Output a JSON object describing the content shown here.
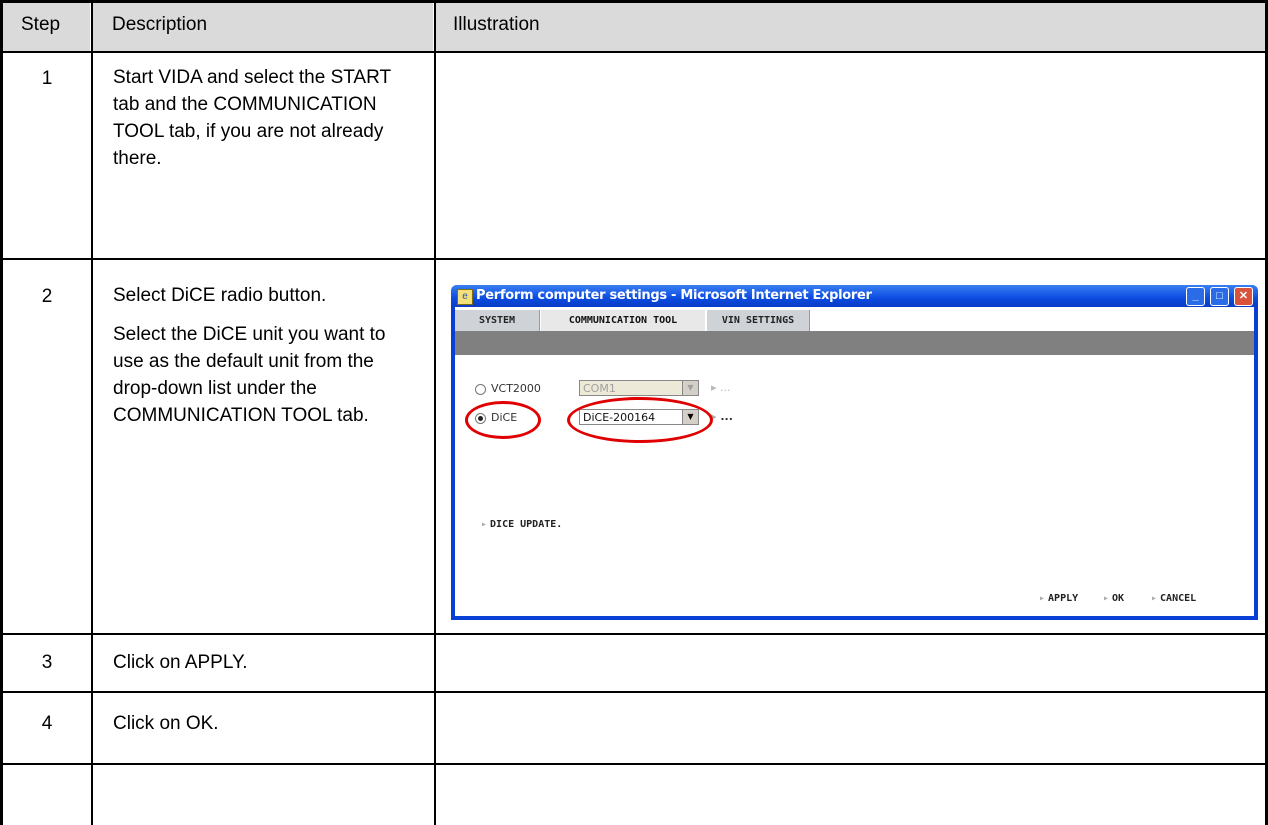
{
  "table": {
    "headers": {
      "step": "Step",
      "description": "Description",
      "illustration": "Illustration"
    },
    "rows": [
      {
        "step": "1",
        "description": [
          "Start VIDA and select the START tab and the COMMUNICATION TOOL tab, if you are not already there."
        ]
      },
      {
        "step": "2",
        "description": [
          "Select DiCE radio button.",
          "Select the DiCE unit you want to use as the default unit from the drop-down list under the COMMUNICATION TOOL tab."
        ]
      },
      {
        "step": "3",
        "description": [
          "Click on APPLY."
        ]
      },
      {
        "step": "4",
        "description": [
          "Click on OK."
        ]
      },
      {
        "step": "",
        "description": [
          ""
        ]
      }
    ]
  },
  "dialog": {
    "title": "Perform computer settings - Microsoft Internet Explorer",
    "window_buttons": {
      "minimize": "_",
      "maximize": "□",
      "close": "✕"
    },
    "tabs": [
      {
        "label": "SYSTEM",
        "active": false
      },
      {
        "label": "COMMUNICATION TOOL",
        "active": true
      },
      {
        "label": "VIN SETTINGS",
        "active": false
      }
    ],
    "options": [
      {
        "label": "VCT2000",
        "selected": false,
        "port": "COM1",
        "enabled": false,
        "more": "..."
      },
      {
        "label": "DiCE",
        "selected": true,
        "port": "DiCE-200164",
        "enabled": true,
        "more": "..."
      }
    ],
    "dice_update": "DICE UPDATE.",
    "actions": {
      "apply": "APPLY",
      "ok": "OK",
      "cancel": "CANCEL"
    },
    "highlight_color": "#e00000"
  }
}
